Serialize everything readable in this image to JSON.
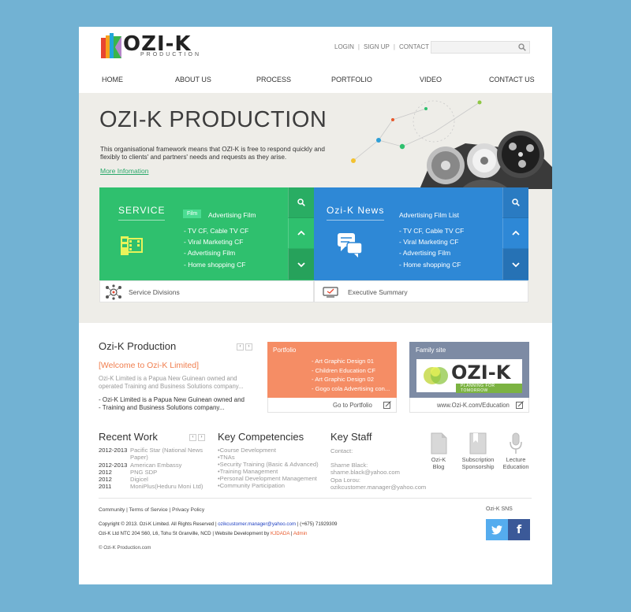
{
  "header": {
    "logo_text": "OZI-K",
    "logo_sub": "PRODUCTION",
    "links": [
      "LOGIN",
      "SIGN UP",
      "CONTACT US"
    ],
    "search_placeholder": ""
  },
  "nav": [
    "HOME",
    "ABOUT US",
    "PROCESS",
    "PORTFOLIO",
    "VIDEO",
    "CONTACT US"
  ],
  "hero": {
    "title": "OZI-K PRODUCTION",
    "desc": "This organisational framework means that OZI-K is free to respond quickly and flexibly to clients' and partners' needs and requests as they arise.",
    "more": "More Infomation"
  },
  "service": {
    "title": "SERVICE",
    "badge": "Film",
    "sub": "Advertising Film",
    "items": [
      "- TV CF, Cable TV CF",
      "- Viral Marketing CF",
      "- Advertising Film",
      "- Home shopping CF"
    ],
    "footer": "Service Divisions"
  },
  "news": {
    "title": "Ozi-K News",
    "sub": "Advertising Film List",
    "items": [
      "- TV CF, Cable TV CF",
      "- Viral Marketing CF",
      "- Advertising Film",
      "- Home shopping CF"
    ],
    "footer": "Executive Summary"
  },
  "about": {
    "title": "Ozi-K Production",
    "welcome": "[Welcome to Ozi-K Limited]",
    "p1": "Ozi-K Limited is a Papua New Guinean owned and operated Training and Business Solutions company...",
    "p2a": "- Ozi-K Limited is a Papua New Guinean owned and",
    "p2b": "- Training and Business Solutions company..."
  },
  "portfolio": {
    "title": "Portfolio",
    "items": [
      "- Art Graphic Design 01",
      "- Children Education CF",
      "- Art Graphic Design 02",
      "- Gogo cola Advertising con..."
    ],
    "footer": "Go to Portfolio"
  },
  "family": {
    "title": "Family site",
    "logo_text": "OZI-K",
    "logo_sub": "PLANNING FOR TOMORROW",
    "footer": "www.Ozi-K.com/Education"
  },
  "recent": {
    "title": "Recent Work",
    "rows": [
      {
        "year": "2012-2013",
        "text": "Pacific Star (National News"
      },
      {
        "year": "",
        "text": "Paper)"
      },
      {
        "year": "2012-2013",
        "text": "American Embassy"
      },
      {
        "year": "2012",
        "text": "PNG SDP"
      },
      {
        "year": "2012",
        "text": "Digicel"
      },
      {
        "year": "2011",
        "text": "MoniPlus(Heduru Moni Ltd)"
      }
    ]
  },
  "competencies": {
    "title": "Key Competencies",
    "items": [
      "•Course Development",
      "•TNAs",
      "•Security Training (Basic & Advanced)",
      "•Training Management",
      "•Personal Development Management",
      "•Community Participation"
    ]
  },
  "staff": {
    "title": "Key Staff",
    "lines": [
      "Contact:",
      "",
      "Sharne Black:",
      "sharne.black@yahoo.com",
      "Opa Lorou:",
      "ozikcustomer.manager@yahoo.com"
    ]
  },
  "quick": [
    {
      "l1": "Ozi-K",
      "l2": "Blog"
    },
    {
      "l1": "Subscription",
      "l2": "Sponsorship"
    },
    {
      "l1": "Lecture",
      "l2": "Education"
    }
  ],
  "footer": {
    "links": [
      "Community",
      "Terms of Service",
      "Privacy Policy"
    ],
    "copy1_a": "Copyright © 2013. Ozi-K Limited. All Rights Reserved | ",
    "copy1_email": "ozikcustomer.manager@yahoo.com",
    "copy1_b": " | (+675) 71929309",
    "copy2_a": "Ozi-K Ltd NTC 204 S60, L6, Tohu St Granville, NCD | Website Development by ",
    "copy2_dev": "KJDADA",
    "copy2_sep": " | ",
    "copy2_admin": "Admin",
    "copy3": "© Ozi-K Production.com",
    "sns_label": "Ozi-K SNS"
  },
  "colors": {
    "green": "#2fc06e",
    "blue": "#2e88d6",
    "orange": "#f58d65",
    "slate": "#7d8ba4",
    "twitter": "#55acee",
    "facebook": "#3b5998"
  }
}
